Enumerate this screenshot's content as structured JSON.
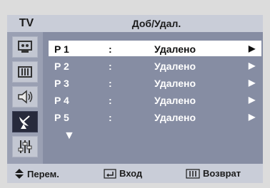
{
  "header": {
    "tv_label": "TV",
    "title": "Доб/Удал."
  },
  "sidebar": {
    "icons": [
      {
        "name": "picture-icon",
        "active": false
      },
      {
        "name": "setup-menu-icon",
        "active": false
      },
      {
        "name": "speaker-icon",
        "active": false
      },
      {
        "name": "satellite-dish-icon",
        "active": true
      },
      {
        "name": "settings-sliders-icon",
        "active": false
      }
    ]
  },
  "channels": [
    {
      "label": "P 1",
      "separator": ":",
      "status": "Удалено",
      "arrow": "▶",
      "selected": true
    },
    {
      "label": "P 2",
      "separator": ":",
      "status": "Удалено",
      "arrow": "▶",
      "selected": false
    },
    {
      "label": "P 3",
      "separator": ":",
      "status": "Удалено",
      "arrow": "▶",
      "selected": false
    },
    {
      "label": "P 4",
      "separator": ":",
      "status": "Удалено",
      "arrow": "▶",
      "selected": false
    },
    {
      "label": "P 5",
      "separator": ":",
      "status": "Удалено",
      "arrow": "▶",
      "selected": false
    }
  ],
  "scroll_indicator": "▼",
  "footer": {
    "move_label": "Перем.",
    "enter_label": "Вход",
    "return_label": "Возврат"
  },
  "colors": {
    "panel_bg": "#858ca3",
    "header_bg": "#c9cdd8",
    "selected_row_bg": "#ffffff",
    "active_icon_bg": "#272a3c"
  }
}
